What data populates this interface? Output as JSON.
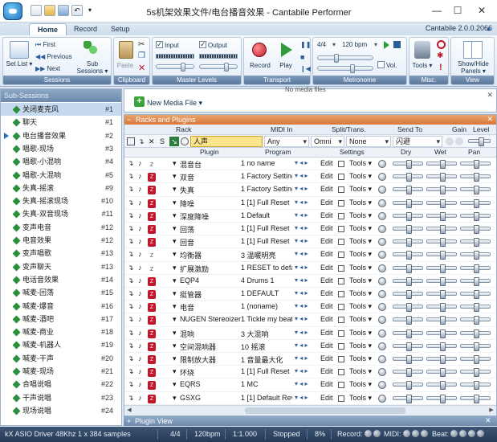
{
  "window": {
    "title": "5s机架效果文件/电台播音效果 - Cantabile Performer",
    "minimize": "—",
    "maximize": "☐",
    "close": "✕"
  },
  "ribbon": {
    "tabs": [
      "Home",
      "Record",
      "Setup"
    ],
    "active_tab": "Home",
    "version": "Cantabile 2.0.0.2066",
    "sessions": {
      "group": "Sessions",
      "set_list": "Set List ▾",
      "first": "First",
      "previous": "Previous",
      "next": "Next",
      "sub_sessions": "Sub Sessions ▾"
    },
    "clipboard": {
      "group": "Clipboard",
      "paste": "Paste"
    },
    "master_levels": {
      "group": "Master Levels",
      "input": "Input",
      "output": "Output"
    },
    "transport": {
      "group": "Transport",
      "record": "Record",
      "play": "Play"
    },
    "metronome": {
      "group": "Metronome",
      "time_sig": "4/4",
      "tempo": "120 bpm",
      "vol": "Vol."
    },
    "misc": {
      "group": "Misc.",
      "tools": "Tools ▾"
    },
    "view": {
      "group": "View",
      "show_hide": "Show/Hide Panels ▾"
    }
  },
  "sidebar": {
    "header": "Sub-Sessions",
    "items": [
      {
        "label": "关闭麦克风",
        "num": "#1"
      },
      {
        "label": "聊天",
        "num": "#1"
      },
      {
        "label": "电台播音效果",
        "num": "#2"
      },
      {
        "label": "唱歌-现场",
        "num": "#3"
      },
      {
        "label": "唱歌-小混响",
        "num": "#4"
      },
      {
        "label": "唱歌-大混响",
        "num": "#5"
      },
      {
        "label": "失真-摇滚",
        "num": "#9"
      },
      {
        "label": "失真-摇滚现场",
        "num": "#10"
      },
      {
        "label": "失真-双音现场",
        "num": "#11"
      },
      {
        "label": "变声电音",
        "num": "#12"
      },
      {
        "label": "电音效果",
        "num": "#12"
      },
      {
        "label": "变声唱歌",
        "num": "#13"
      },
      {
        "label": "变声聊天",
        "num": "#13"
      },
      {
        "label": "电话音效果",
        "num": "#14"
      },
      {
        "label": "喊麦-回荡",
        "num": "#15"
      },
      {
        "label": "喊麦-爆音",
        "num": "#16"
      },
      {
        "label": "喊麦-酒吧",
        "num": "#17"
      },
      {
        "label": "喊麦-商业",
        "num": "#18"
      },
      {
        "label": "喊麦-机器人",
        "num": "#19"
      },
      {
        "label": "喊麦-干声",
        "num": "#20"
      },
      {
        "label": "喊麦-现场",
        "num": "#21"
      },
      {
        "label": "合唱说唱",
        "num": "#22"
      },
      {
        "label": "干声说唱",
        "num": "#23"
      },
      {
        "label": "现场说唱",
        "num": "#24"
      }
    ]
  },
  "media": {
    "caption": "No media files",
    "new_media": "New Media File ▾"
  },
  "racks": {
    "header": "Racks and Plugins",
    "columns": {
      "rack": "Rack",
      "midi_in": "MIDI In",
      "split": "Split/Trans.",
      "send_to": "Send To",
      "gain": "Gain",
      "level": "Level"
    },
    "rack_row": {
      "name": "人声",
      "midi_any": "Any",
      "midi_omni": "Omni",
      "split_none": "None",
      "send": "闪避"
    },
    "plugin_columns": {
      "plugin": "Plugin",
      "program": "Program",
      "settings": "Settings",
      "dry": "Dry",
      "wet": "Wet",
      "pan": "Pan"
    },
    "edit_label": "Edit",
    "tools_label": "Tools ▾",
    "plugins": [
      {
        "name": "混音台",
        "program": "1 no name",
        "active": false
      },
      {
        "name": "双音",
        "program": "1 Factory Setting",
        "active": true
      },
      {
        "name": "失真",
        "program": "1 Factory Setting",
        "active": true
      },
      {
        "name": "降噪",
        "program": "1 [1] Full Reset",
        "active": true
      },
      {
        "name": "深度降噪",
        "program": "1 Default",
        "active": true
      },
      {
        "name": "回荡",
        "program": "1 [1] Full Reset",
        "active": true
      },
      {
        "name": "回音",
        "program": "1 [1] Full Reset",
        "active": true
      },
      {
        "name": "均衡器",
        "program": "3 温暖明亮",
        "active": false
      },
      {
        "name": "扩展激励",
        "program": "1 RESET to default",
        "active": false
      },
      {
        "name": "EQP4",
        "program": "4 Drums 1",
        "active": true
      },
      {
        "name": "挺管器",
        "program": "1  DEFAULT",
        "active": true
      },
      {
        "name": "电音",
        "program": "1 (noname)",
        "active": true
      },
      {
        "name": "NUGEN Stereoizer",
        "program": "1 Tickle my beats",
        "active": true
      },
      {
        "name": "混响",
        "program": "3 大混响",
        "active": true
      },
      {
        "name": "空间混响器",
        "program": "10 摇滚",
        "active": true
      },
      {
        "name": "限制放大器",
        "program": "1 音量最大化",
        "active": true
      },
      {
        "name": "环绕",
        "program": "1 [1] Full Reset",
        "active": true
      },
      {
        "name": "EQRS",
        "program": "1 MC",
        "active": true
      },
      {
        "name": "GSXG",
        "program": "1 [1] Default Reverb",
        "active": true
      }
    ]
  },
  "plugin_view": "Plugin View",
  "status": {
    "driver": "kX ASIO Driver 48Khz 1 x 384 samples",
    "time_sig": "4/4",
    "tempo": "120bpm",
    "position": "1:1.000",
    "state": "Stopped",
    "cpu": "8%",
    "record": "Record:",
    "midi": "MIDI:",
    "beat": "Beat:"
  },
  "colors": {
    "accent": "#d9773a",
    "ribbon_label": "#5a789d",
    "status": "#243a55",
    "active_plugin": "#c0182a"
  }
}
